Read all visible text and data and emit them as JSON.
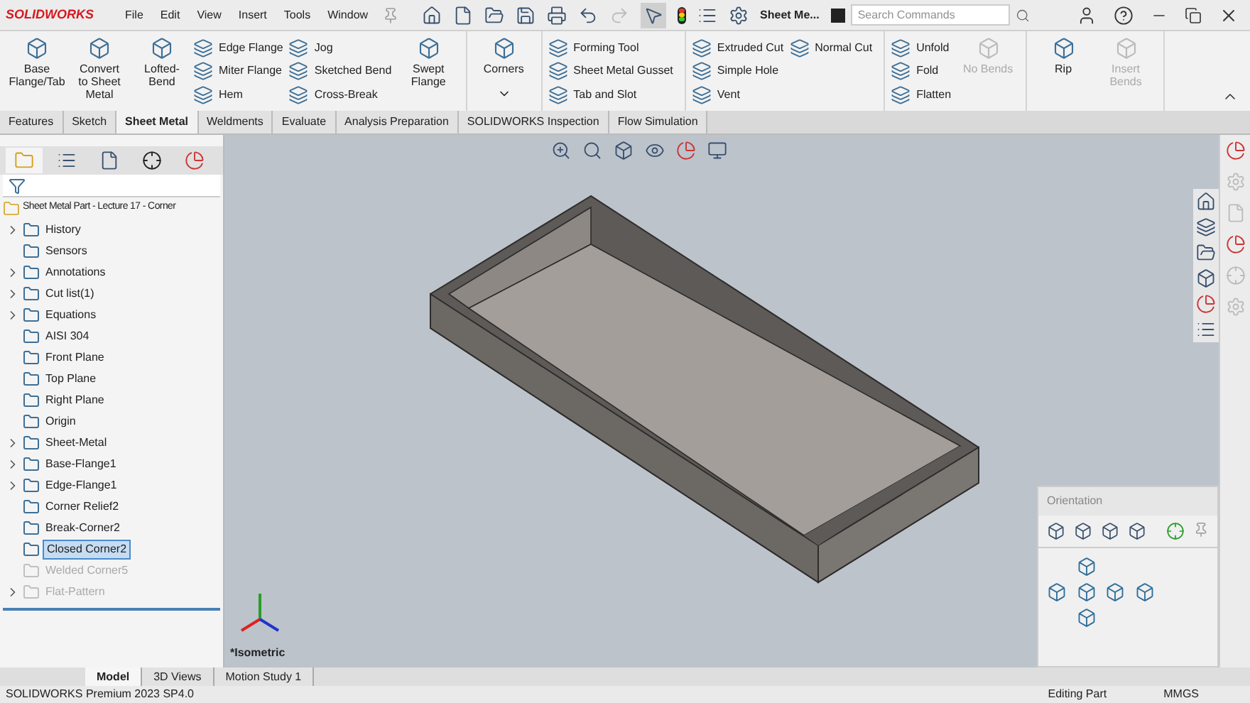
{
  "app": {
    "logo": "SOLIDWORKS",
    "menus": [
      "File",
      "Edit",
      "View",
      "Insert",
      "Tools",
      "Window"
    ],
    "document": "Sheet Me...",
    "search": {
      "placeholder": "Search Commands"
    }
  },
  "ribbon": {
    "sections": [
      [
        {
          "kind": "large",
          "label": "Base Flange/Tab",
          "disabled": false,
          "dropdown": false
        },
        {
          "kind": "large",
          "label": "Convert to Sheet Metal",
          "disabled": false,
          "dropdown": false
        },
        {
          "kind": "large",
          "label": "Lofted-Bend",
          "disabled": false,
          "dropdown": false
        },
        {
          "kind": "column",
          "items": [
            "Edge Flange",
            "Miter Flange",
            "Hem"
          ]
        },
        {
          "kind": "column",
          "items": [
            "Jog",
            "Sketched Bend",
            "Cross-Break"
          ]
        },
        {
          "kind": "large",
          "label": "Swept Flange",
          "disabled": false,
          "dropdown": false
        }
      ],
      [
        {
          "kind": "large",
          "label": "Corners",
          "disabled": false,
          "dropdown": true
        }
      ],
      [
        {
          "kind": "column",
          "items": [
            "Forming Tool",
            "Sheet Metal Gusset",
            "Tab and Slot"
          ]
        }
      ],
      [
        {
          "kind": "column",
          "items": [
            "Extruded Cut",
            "Simple Hole",
            "Vent"
          ]
        },
        {
          "kind": "column",
          "items": [
            "Normal Cut"
          ]
        }
      ],
      [
        {
          "kind": "column",
          "items": [
            "Unfold",
            "Fold",
            "Flatten"
          ]
        },
        {
          "kind": "large",
          "label": "No Bends",
          "disabled": true,
          "dropdown": false
        }
      ],
      [
        {
          "kind": "large",
          "label": "Rip",
          "disabled": false,
          "dropdown": false
        },
        {
          "kind": "large",
          "label": "Insert Bends",
          "disabled": true,
          "dropdown": false
        }
      ]
    ]
  },
  "tabs": [
    {
      "label": "Features",
      "selected": false
    },
    {
      "label": "Sketch",
      "selected": false
    },
    {
      "label": "Sheet Metal",
      "selected": true
    },
    {
      "label": "Weldments",
      "selected": false
    },
    {
      "label": "Evaluate",
      "selected": false
    },
    {
      "label": "Analysis Preparation",
      "selected": false
    },
    {
      "label": "SOLIDWORKS Inspection",
      "selected": false
    },
    {
      "label": "Flow Simulation",
      "selected": false
    }
  ],
  "feature_tree": {
    "root": "Sheet Metal Part - Lecture 17 - Corner",
    "items": [
      {
        "label": "History",
        "expandable": true,
        "selected": false,
        "suppressed": false
      },
      {
        "label": "Sensors",
        "expandable": false,
        "selected": false,
        "suppressed": false
      },
      {
        "label": "Annotations",
        "expandable": true,
        "selected": false,
        "suppressed": false
      },
      {
        "label": "Cut list(1)",
        "expandable": true,
        "selected": false,
        "suppressed": false
      },
      {
        "label": "Equations",
        "expandable": true,
        "selected": false,
        "suppressed": false
      },
      {
        "label": "AISI 304",
        "expandable": false,
        "selected": false,
        "suppressed": false
      },
      {
        "label": "Front Plane",
        "expandable": false,
        "selected": false,
        "suppressed": false
      },
      {
        "label": "Top Plane",
        "expandable": false,
        "selected": false,
        "suppressed": false
      },
      {
        "label": "Right Plane",
        "expandable": false,
        "selected": false,
        "suppressed": false
      },
      {
        "label": "Origin",
        "expandable": false,
        "selected": false,
        "suppressed": false
      },
      {
        "label": "Sheet-Metal",
        "expandable": true,
        "selected": false,
        "suppressed": false
      },
      {
        "label": "Base-Flange1",
        "expandable": true,
        "selected": false,
        "suppressed": false
      },
      {
        "label": "Edge-Flange1",
        "expandable": true,
        "selected": false,
        "suppressed": false
      },
      {
        "label": "Corner Relief2",
        "expandable": false,
        "selected": false,
        "suppressed": false
      },
      {
        "label": "Break-Corner2",
        "expandable": false,
        "selected": false,
        "suppressed": false
      },
      {
        "label": "Closed Corner2",
        "expandable": false,
        "selected": true,
        "suppressed": false
      },
      {
        "label": "Welded Corner5",
        "expandable": false,
        "selected": false,
        "suppressed": true
      },
      {
        "label": "Flat-Pattern",
        "expandable": true,
        "selected": false,
        "suppressed": true
      }
    ]
  },
  "viewport": {
    "view_name": "*Isometric"
  },
  "orientation_panel": {
    "title": "Orientation"
  },
  "bottom_tabs": [
    {
      "label": "Model",
      "selected": true
    },
    {
      "label": "3D Views",
      "selected": false
    },
    {
      "label": "Motion Study 1",
      "selected": false
    }
  ],
  "status_bar": {
    "product": "SOLIDWORKS Premium 2023 SP4.0",
    "mode": "Editing Part",
    "units": "MMGS"
  }
}
